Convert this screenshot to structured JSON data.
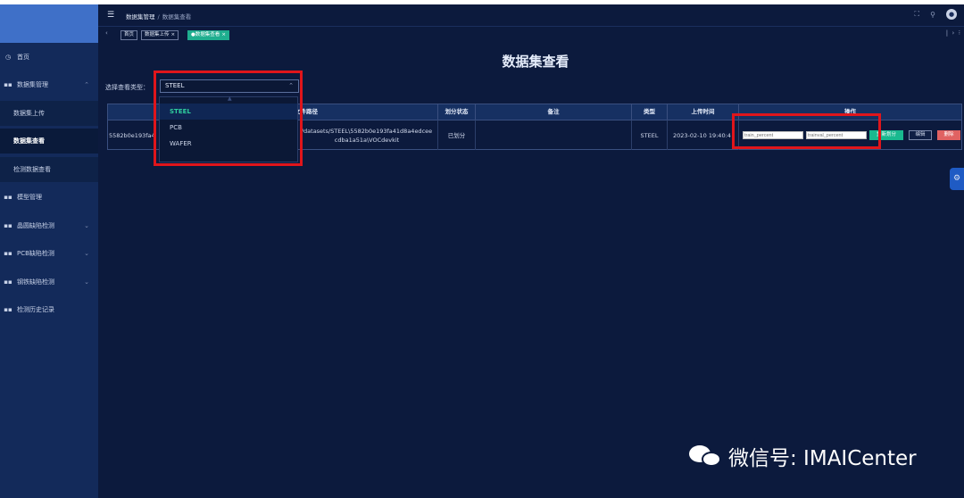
{
  "header": {
    "breadcrumb": [
      "数据集管理",
      "数据集查看"
    ],
    "icons": [
      "fullscreen-icon",
      "search-icon",
      "user-avatar-icon"
    ]
  },
  "tabs": [
    {
      "label": "首页",
      "active": false
    },
    {
      "label": "数据集上传",
      "active": false
    },
    {
      "label": "●数据集查看",
      "active": true
    }
  ],
  "sidebar": {
    "items": [
      {
        "label": "首页",
        "icon": "home-icon"
      },
      {
        "label": "数据集管理",
        "icon": "grid-icon",
        "expanded": true,
        "children": [
          "数据集上传",
          "数据集查看",
          "检测数据查看"
        ],
        "active_child": "数据集查看"
      },
      {
        "label": "模型管理",
        "icon": "grid-icon"
      },
      {
        "label": "晶圆缺陷检测",
        "icon": "grid-icon"
      },
      {
        "label": "PCB缺陷检测",
        "icon": "grid-icon"
      },
      {
        "label": "钢铁缺陷检测",
        "icon": "grid-icon"
      },
      {
        "label": "检测历史记录",
        "icon": "grid-icon"
      }
    ]
  },
  "main": {
    "title": "数据集查看",
    "select_label": "选择查看类型：",
    "select_value": "STEEL",
    "dropdown_options": [
      "STEEL",
      "PCB",
      "WAFER"
    ],
    "table": {
      "headers": [
        "",
        "文件路径",
        "划分状态",
        "备注",
        "类型",
        "上传时间",
        "操作"
      ],
      "rows": [
        {
          "id": "5582b0e193fa4",
          "path_line1": "/datasets/STEEL\\5582b0e193fa41d8a4edcee",
          "path_line2": "cdba1a51a\\VOCdevkit",
          "status": "已划分",
          "note": "",
          "type": "STEEL",
          "time": "2023-02-10 19:40:4",
          "train_placeholder": "train_percent",
          "trainval_placeholder": "trainval_percent",
          "btn_split": "重新划分",
          "btn_edit": "编辑",
          "btn_delete": "删除"
        }
      ]
    }
  },
  "watermark": "微信号: IMAICenter",
  "colors": {
    "accent": "#1fae8f",
    "danger": "#e06262",
    "highlight": "#e0151b",
    "sidebar": "#132a5a",
    "background": "#0c1a3d"
  }
}
